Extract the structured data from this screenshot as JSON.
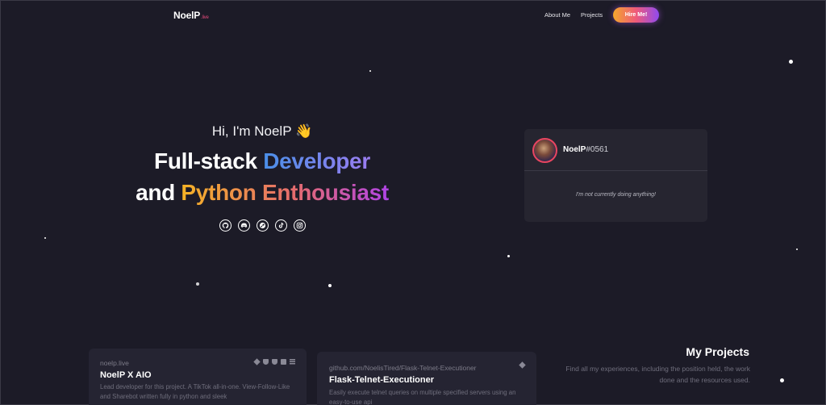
{
  "nav": {
    "brand": "NoelP",
    "brand_tld": ".live",
    "about": "About Me",
    "projects": "Projects",
    "hire": "Hire Me!"
  },
  "hero": {
    "greeting": "Hi, I'm NoelP 👋",
    "line1_plain": "Full-stack ",
    "line1_accent": "Developer",
    "line2_plain": "and ",
    "line2_accent": "Python Enthousiast",
    "socials": [
      "github-icon",
      "discord-icon",
      "steam-icon",
      "tiktok-icon",
      "instagram-icon"
    ]
  },
  "discord": {
    "username": "NoelP",
    "tag": "#0561",
    "status": "I'm not currently doing anything!",
    "ring_color": "#e94560"
  },
  "projects_section": {
    "title": "My Projects",
    "description": "Find all my experiences, including the position held, the work done and the resources used."
  },
  "projects": [
    {
      "url": "noelp.live",
      "title": "NoelP X AIO",
      "description": "Lead developer for this project. A TikTok all-in-one. View-Follow-Like and Sharebot written fully in python and sleek"
    },
    {
      "url": "github.com/NoelisTired/Flask-Telnet-Executioner",
      "title": "Flask-Telnet-Executioner",
      "description": "Easily execute telnet queries on multiple specified servers using an easy-to-use api"
    }
  ],
  "colors": {
    "background": "#1c1b27",
    "card": "#262530",
    "accent_blue": "#4a8fe8",
    "accent_orange": "#f5b325",
    "accent_purple": "#b044e6"
  }
}
